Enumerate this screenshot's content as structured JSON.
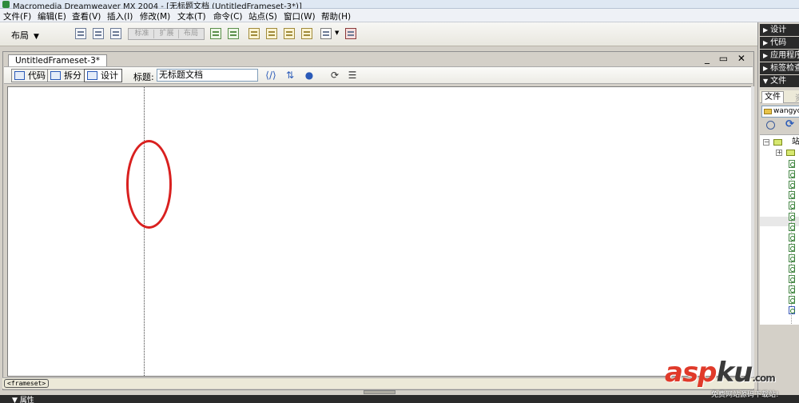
{
  "app": {
    "title": "Macromedia Dreamweaver MX 2004 - [无标题文档 (UntitledFrameset-3*)]"
  },
  "menu": [
    "文件(F)",
    "编辑(E)",
    "查看(V)",
    "插入(I)",
    "修改(M)",
    "文本(T)",
    "命令(C)",
    "站点(S)",
    "窗口(W)",
    "帮助(H)"
  ],
  "insert_toolbar": {
    "category": "布局",
    "modes": [
      "标准",
      "扩展",
      "布局"
    ]
  },
  "document": {
    "tab": "UntitledFrameset-3*",
    "window_controls": "_ ▭ ✕",
    "views": {
      "code": "代码",
      "split": "拆分",
      "design": "设计"
    },
    "title_label": "标题:",
    "title_value": "无标题文档",
    "tag_selector": "<frameset>"
  },
  "panels": {
    "groups": [
      "设计",
      "代码",
      "应用程序",
      "标签检查器",
      "文件"
    ],
    "files": {
      "tabs": [
        "文件",
        "资"
      ],
      "site": "wangyc",
      "root_label": "站"
    }
  },
  "properties": {
    "label": "▼ 属性"
  },
  "watermark": {
    "logo_main": "asp",
    "logo_accent": "ku",
    "logo_tld": ".com",
    "subtitle": "免费网站源码下载站!"
  },
  "colors": {
    "annotation": "#d9201f",
    "dark_panel": "#2a2a2a",
    "watermark_red": "#e03a2a"
  },
  "icons": {
    "refresh": "⟳",
    "globe": "●"
  }
}
